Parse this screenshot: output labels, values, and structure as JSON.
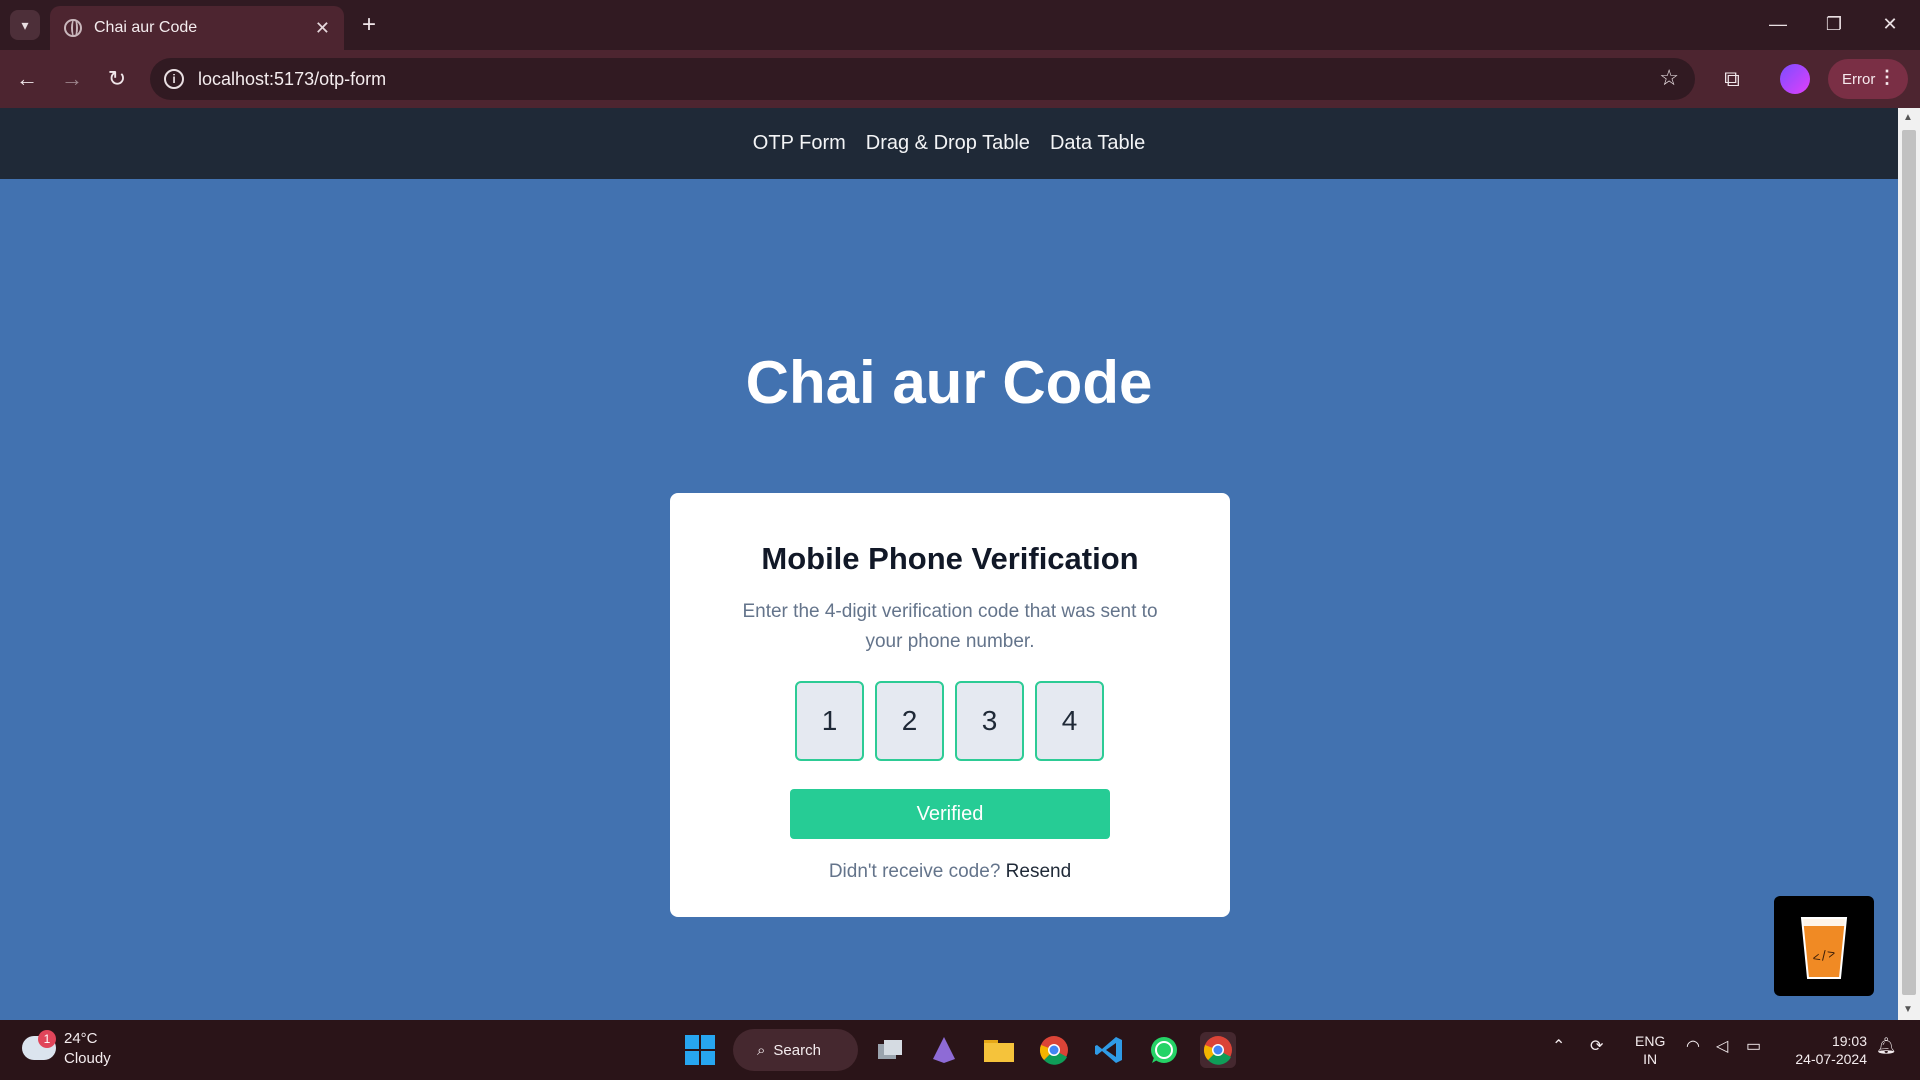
{
  "browser": {
    "tab_title": "Chai aur Code",
    "tab_close": "✕",
    "new_tab": "+",
    "url": "localhost:5173/otp-form",
    "profile_status": "Error"
  },
  "site_nav": {
    "links": [
      "OTP Form",
      "Drag & Drop Table",
      "Data Table"
    ]
  },
  "page": {
    "heading": "Chai aur Code"
  },
  "card": {
    "title": "Mobile Phone Verification",
    "description": "Enter the 4-digit verification code that was sent to your phone number.",
    "otp_digits": [
      "1",
      "2",
      "3",
      "4"
    ],
    "submit_label": "Verified",
    "resend_prompt": "Didn't receive code?",
    "resend_link": "Resend"
  },
  "badge": {
    "code_glyph": "</>"
  },
  "taskbar": {
    "weather_count": "1",
    "temperature": "24°C",
    "condition": "Cloudy",
    "search_label": "Search",
    "lang_top": "ENG",
    "lang_bottom": "IN",
    "time": "19:03",
    "date": "24-07-2024"
  },
  "colors": {
    "page_bg": "#4272b0",
    "nav_bg": "#1f2937",
    "accent": "#26cc95",
    "chrome_dark": "#311a22",
    "chrome_mid": "#4d2530"
  }
}
